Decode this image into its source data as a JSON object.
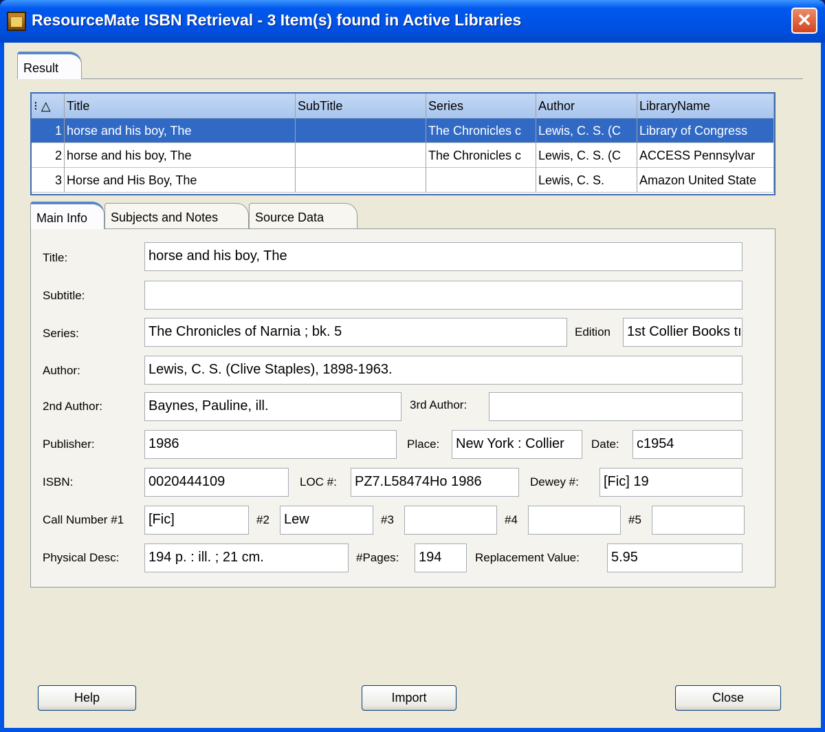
{
  "window": {
    "title": "ResourceMate ISBN Retrieval - 3 Item(s) found in Active Libraries",
    "close_glyph": "✕"
  },
  "outer_tab": "Result",
  "grid": {
    "sort_col_label": "⁝ △",
    "columns": [
      "Title",
      "SubTitle",
      "Series",
      "Author",
      "LibraryName"
    ],
    "rows": [
      {
        "n": "1",
        "cells": [
          "horse and his boy, The",
          "",
          "The Chronicles c",
          "Lewis, C. S. (C",
          "Library of Congress"
        ],
        "selected": true
      },
      {
        "n": "2",
        "cells": [
          "horse and his boy, The",
          "",
          "The Chronicles c",
          "Lewis, C. S. (C",
          "ACCESS Pennsylvar"
        ],
        "selected": false
      },
      {
        "n": "3",
        "cells": [
          "Horse and His Boy, The",
          "",
          "",
          "Lewis, C. S.",
          "Amazon United State"
        ],
        "selected": false
      }
    ]
  },
  "tabs": [
    "Main Info",
    "Subjects and Notes",
    "Source Data"
  ],
  "form": {
    "title": {
      "label": "Title:",
      "value": "horse and his boy, The"
    },
    "subtitle": {
      "label": "Subtitle:",
      "value": ""
    },
    "series": {
      "label": "Series:",
      "value": "The Chronicles of Narnia ; bk. 5"
    },
    "edition": {
      "label": "Edition",
      "value": "1st Collier Books tı"
    },
    "author": {
      "label": "Author:",
      "value": "Lewis, C. S. (Clive Staples), 1898-1963."
    },
    "author2": {
      "label": "2nd Author:",
      "value": "Baynes, Pauline, ill."
    },
    "author3": {
      "label": "3rd Author:",
      "value": ""
    },
    "publisher": {
      "label": "Publisher:",
      "value": "1986"
    },
    "place": {
      "label": "Place:",
      "value": "New York : Collier"
    },
    "date": {
      "label": "Date:",
      "value": "c1954"
    },
    "isbn": {
      "label": "ISBN:",
      "value": "0020444109"
    },
    "loc": {
      "label": "LOC #:",
      "value": "PZ7.L58474Ho 1986"
    },
    "dewey": {
      "label": "Dewey #:",
      "value": "[Fic] 19"
    },
    "call1": {
      "label": "Call Number #1",
      "value": "[Fic]"
    },
    "call2": {
      "label": "#2",
      "value": "Lew"
    },
    "call3": {
      "label": "#3",
      "value": ""
    },
    "call4": {
      "label": "#4",
      "value": ""
    },
    "call5": {
      "label": "#5",
      "value": ""
    },
    "phys": {
      "label": "Physical Desc:",
      "value": "194 p. : ill. ; 21 cm."
    },
    "pages": {
      "label": "#Pages:",
      "value": "194"
    },
    "repl": {
      "label": "Replacement Value:",
      "value": "5.95"
    }
  },
  "buttons": {
    "help": "Help",
    "import": "Import",
    "close": "Close"
  }
}
